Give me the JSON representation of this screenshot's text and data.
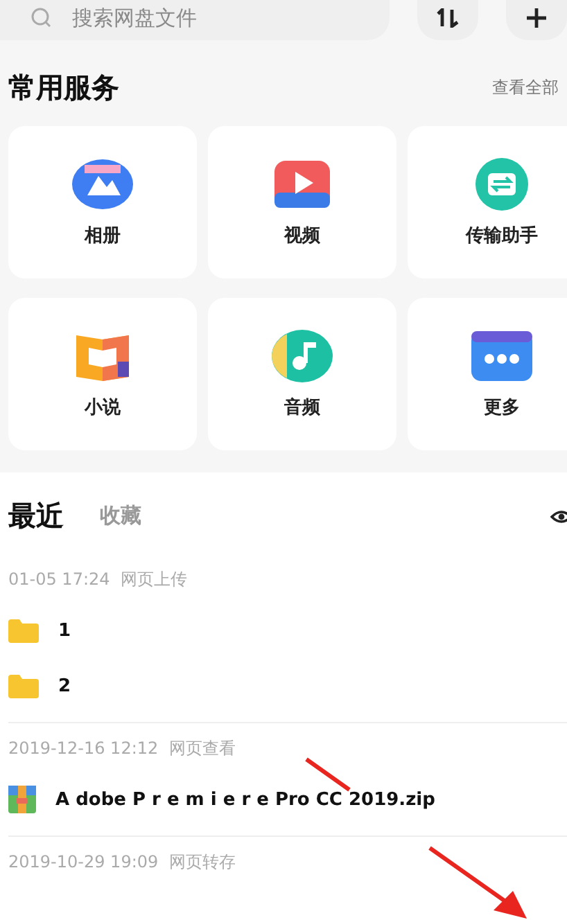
{
  "search": {
    "placeholder": "搜索网盘文件"
  },
  "services": {
    "title": "常用服务",
    "more": "查看全部",
    "items": [
      {
        "kind": "album",
        "label": "相册"
      },
      {
        "kind": "video",
        "label": "视频"
      },
      {
        "kind": "transfer",
        "label": "传输助手"
      },
      {
        "kind": "novel",
        "label": "小说"
      },
      {
        "kind": "audio",
        "label": "音频"
      },
      {
        "kind": "more",
        "label": "更多"
      }
    ]
  },
  "tabs": [
    {
      "label": "最近",
      "selected": true
    },
    {
      "label": "收藏",
      "selected": false
    }
  ],
  "groups": [
    {
      "time": "01-05 17:24",
      "source": "网页上传",
      "files": [
        {
          "kind": "folder",
          "name": "1"
        },
        {
          "kind": "folder",
          "name": "2"
        }
      ]
    },
    {
      "time": "2019-12-16 12:12",
      "source": "网页查看",
      "files": [
        {
          "kind": "zip",
          "name": "A dobe P r e m i e r e Pro CC 2019.zip"
        }
      ]
    },
    {
      "time": "2019-10-29 19:09",
      "source": "网页转存"
    }
  ]
}
